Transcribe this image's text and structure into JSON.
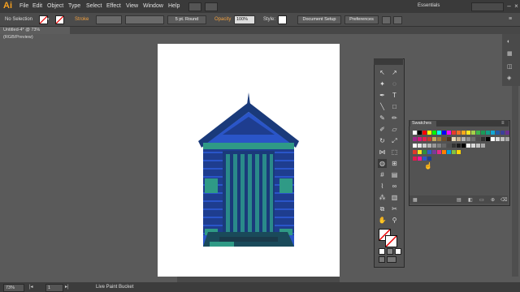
{
  "app": {
    "logo": "Ai"
  },
  "menu": [
    "File",
    "Edit",
    "Object",
    "Type",
    "Select",
    "Effect",
    "View",
    "Window",
    "Help"
  ],
  "workspace": "Essentials",
  "control": {
    "selection": "No Selection",
    "stroke_label": "Stroke",
    "brush_value": "5 pt. Round",
    "opacity_label": "Opacity",
    "opacity_value": "100%",
    "style_label": "Style:",
    "document_setup": "Document Setup",
    "preferences": "Preferences"
  },
  "document": {
    "tab_title": "Untitled-4* @ 73% (RGB/Preview)"
  },
  "status": {
    "zoom": "73%",
    "page": "1",
    "tool_name": "Live Paint Bucket"
  },
  "swatches_panel": {
    "title": "Swatches"
  },
  "colors": {
    "hut_dark": "#1e3d8f",
    "hut_mid": "#2a55c8",
    "hut_teal": "#2a8a8a",
    "hut_green": "#2f9a86",
    "roof": "#1a3a7a",
    "ground": "#1a4a5a"
  },
  "swatch_rows": [
    [
      "#ffffff",
      "#000000",
      "#ff0000",
      "#ffff00",
      "#00ff00",
      "#00ffff",
      "#0000ff",
      "#ff00ff",
      "#e73c2a",
      "#f06f22",
      "#f7a81b",
      "#fbe920",
      "#a6d14a",
      "#3cb64b",
      "#1a9b56",
      "#119f88",
      "#12a7d4",
      "#2459a9",
      "#3a3f99",
      "#6a2f92"
    ],
    [
      "#a1278c",
      "#d8147b",
      "#e61f4b",
      "#c03e2e",
      "#c4a75a",
      "#9c7a3e",
      "#6d4f2b",
      "#4b3221",
      "#e8d9b5",
      "#c7b08a",
      "#b2b2b2",
      "#8f8f8f",
      "#6e6e6e",
      "#4c4c4c",
      "#2f2f2f",
      "#000000",
      "#ffffff",
      "#d9d9d9",
      "#bfbfbf",
      "#a6a6a6"
    ],
    [
      "#ffffff",
      "#e6e6e6",
      "#cccccc",
      "#b3b3b3",
      "#999999",
      "#808080",
      "#666666",
      "#4d4d4d",
      "#333333",
      "#1a1a1a",
      "#000000",
      "#f2f2f2",
      "#dadada",
      "#c2c2c2",
      "#aaaaaa"
    ],
    [
      "#e03a2a",
      "#f5e620",
      "#2e8f3e",
      "#2a5fc8",
      "#7a3a9a",
      "#e62a8a",
      "#ff7f00",
      "#00a0e0",
      "#80c040",
      "#ffd700"
    ],
    [
      "#e6194b",
      "#ff1493",
      "#2a55c8",
      "#1e3d8f"
    ]
  ]
}
